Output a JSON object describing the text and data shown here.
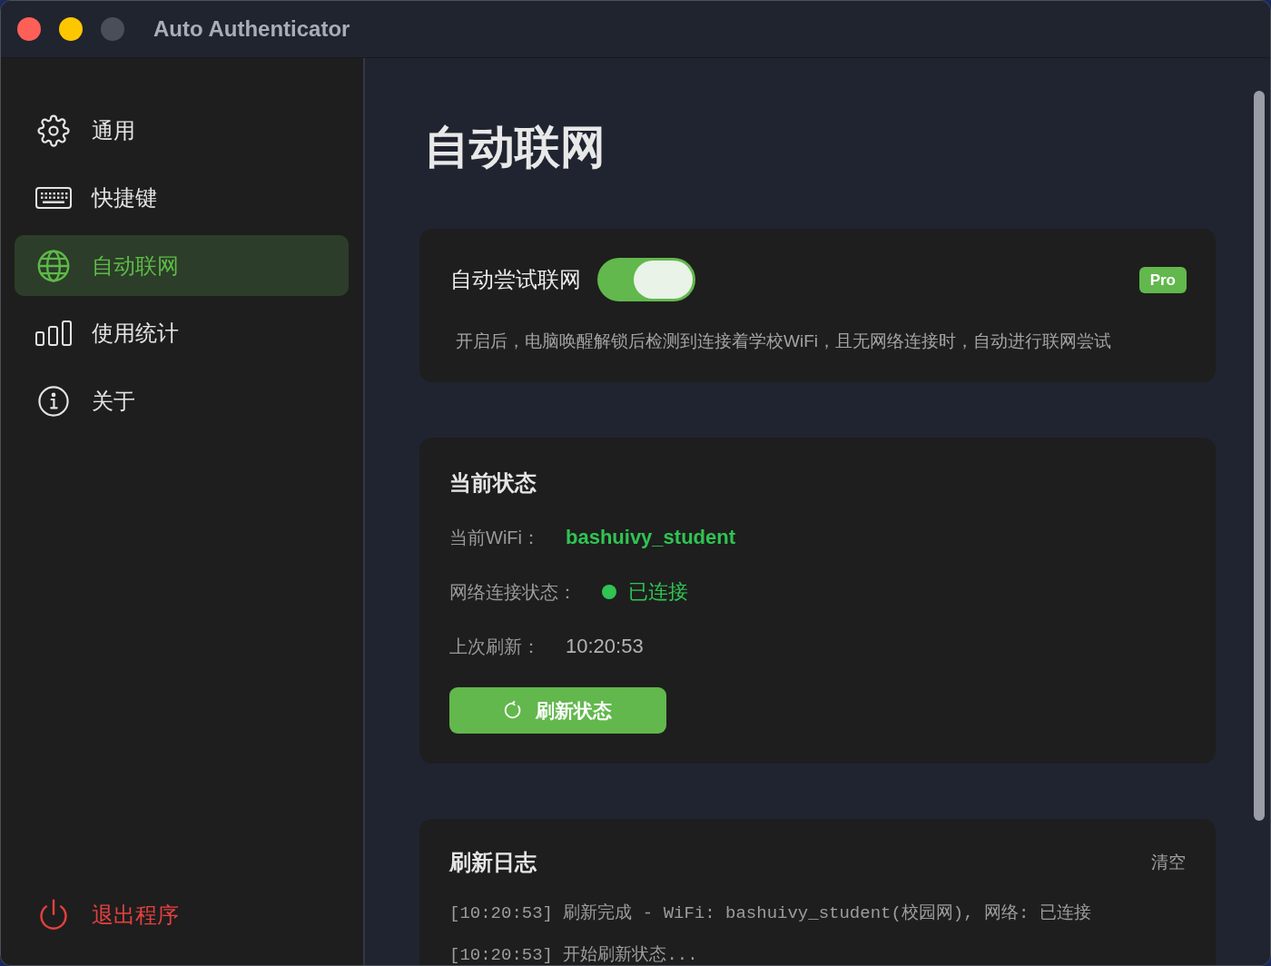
{
  "window": {
    "title": "Auto Authenticator",
    "controls": [
      {
        "kind": "close",
        "disabled": false
      },
      {
        "kind": "minimize",
        "disabled": false
      },
      {
        "kind": "zoom",
        "disabled": true
      }
    ]
  },
  "sidebar": {
    "items": [
      {
        "kind": "settings",
        "label": "通用",
        "selected": false
      },
      {
        "kind": "shortcuts",
        "label": "快捷键",
        "selected": false
      },
      {
        "kind": "network",
        "label": "自动联网",
        "selected": true
      },
      {
        "kind": "stats",
        "label": "使用统计",
        "selected": false
      },
      {
        "kind": "about",
        "label": "关于",
        "selected": false
      }
    ],
    "quit": {
      "label": "退出程序"
    }
  },
  "page": {
    "title": "自动联网"
  },
  "auto_connect": {
    "label": "自动尝试联网",
    "on": true,
    "badge": "Pro",
    "description": "开启后，电脑唤醒解锁后检测到连接着学校WiFi，且无网络连接时，自动进行联网尝试"
  },
  "status": {
    "title": "当前状态",
    "rows": [
      {
        "kind": "wifi",
        "label": "当前WiFi：",
        "value": "bashuivy_student"
      },
      {
        "kind": "connection",
        "label": "网络连接状态：",
        "value": "已连接",
        "connected": true
      },
      {
        "kind": "time",
        "label": "上次刷新：",
        "value": "10:20:53"
      }
    ],
    "refresh_button": "刷新状态"
  },
  "log": {
    "title": "刷新日志",
    "clear_button": "清空",
    "lines": [
      "[10:20:53] 刷新完成 - WiFi: bashuivy_student(校园网), 网络: 已连接",
      "[10:20:53] 开始刷新状态..."
    ]
  }
}
